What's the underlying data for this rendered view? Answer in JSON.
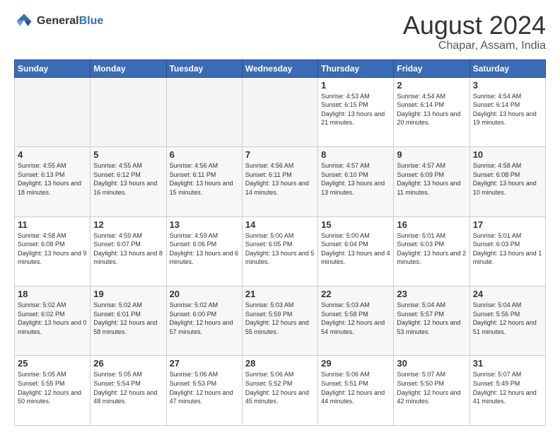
{
  "header": {
    "logo_general": "General",
    "logo_blue": "Blue",
    "month_year": "August 2024",
    "location": "Chapar, Assam, India"
  },
  "weekdays": [
    "Sunday",
    "Monday",
    "Tuesday",
    "Wednesday",
    "Thursday",
    "Friday",
    "Saturday"
  ],
  "weeks": [
    [
      {
        "day": "",
        "empty": true
      },
      {
        "day": "",
        "empty": true
      },
      {
        "day": "",
        "empty": true
      },
      {
        "day": "",
        "empty": true
      },
      {
        "day": "1",
        "sunrise": "4:53 AM",
        "sunset": "6:15 PM",
        "daylight": "13 hours and 21 minutes."
      },
      {
        "day": "2",
        "sunrise": "4:54 AM",
        "sunset": "6:14 PM",
        "daylight": "13 hours and 20 minutes."
      },
      {
        "day": "3",
        "sunrise": "4:54 AM",
        "sunset": "6:14 PM",
        "daylight": "13 hours and 19 minutes."
      }
    ],
    [
      {
        "day": "4",
        "sunrise": "4:55 AM",
        "sunset": "6:13 PM",
        "daylight": "13 hours and 18 minutes."
      },
      {
        "day": "5",
        "sunrise": "4:55 AM",
        "sunset": "6:12 PM",
        "daylight": "13 hours and 16 minutes."
      },
      {
        "day": "6",
        "sunrise": "4:56 AM",
        "sunset": "6:11 PM",
        "daylight": "13 hours and 15 minutes."
      },
      {
        "day": "7",
        "sunrise": "4:56 AM",
        "sunset": "6:11 PM",
        "daylight": "13 hours and 14 minutes."
      },
      {
        "day": "8",
        "sunrise": "4:57 AM",
        "sunset": "6:10 PM",
        "daylight": "13 hours and 13 minutes."
      },
      {
        "day": "9",
        "sunrise": "4:57 AM",
        "sunset": "6:09 PM",
        "daylight": "13 hours and 11 minutes."
      },
      {
        "day": "10",
        "sunrise": "4:58 AM",
        "sunset": "6:08 PM",
        "daylight": "13 hours and 10 minutes."
      }
    ],
    [
      {
        "day": "11",
        "sunrise": "4:58 AM",
        "sunset": "6:08 PM",
        "daylight": "13 hours and 9 minutes."
      },
      {
        "day": "12",
        "sunrise": "4:59 AM",
        "sunset": "6:07 PM",
        "daylight": "13 hours and 8 minutes."
      },
      {
        "day": "13",
        "sunrise": "4:59 AM",
        "sunset": "6:06 PM",
        "daylight": "13 hours and 6 minutes."
      },
      {
        "day": "14",
        "sunrise": "5:00 AM",
        "sunset": "6:05 PM",
        "daylight": "13 hours and 5 minutes."
      },
      {
        "day": "15",
        "sunrise": "5:00 AM",
        "sunset": "6:04 PM",
        "daylight": "13 hours and 4 minutes."
      },
      {
        "day": "16",
        "sunrise": "5:01 AM",
        "sunset": "6:03 PM",
        "daylight": "13 hours and 2 minutes."
      },
      {
        "day": "17",
        "sunrise": "5:01 AM",
        "sunset": "6:03 PM",
        "daylight": "13 hours and 1 minute."
      }
    ],
    [
      {
        "day": "18",
        "sunrise": "5:02 AM",
        "sunset": "6:02 PM",
        "daylight": "13 hours and 0 minutes."
      },
      {
        "day": "19",
        "sunrise": "5:02 AM",
        "sunset": "6:01 PM",
        "daylight": "12 hours and 58 minutes."
      },
      {
        "day": "20",
        "sunrise": "5:02 AM",
        "sunset": "6:00 PM",
        "daylight": "12 hours and 57 minutes."
      },
      {
        "day": "21",
        "sunrise": "5:03 AM",
        "sunset": "5:59 PM",
        "daylight": "12 hours and 55 minutes."
      },
      {
        "day": "22",
        "sunrise": "5:03 AM",
        "sunset": "5:58 PM",
        "daylight": "12 hours and 54 minutes."
      },
      {
        "day": "23",
        "sunrise": "5:04 AM",
        "sunset": "5:57 PM",
        "daylight": "12 hours and 53 minutes."
      },
      {
        "day": "24",
        "sunrise": "5:04 AM",
        "sunset": "5:56 PM",
        "daylight": "12 hours and 51 minutes."
      }
    ],
    [
      {
        "day": "25",
        "sunrise": "5:05 AM",
        "sunset": "5:55 PM",
        "daylight": "12 hours and 50 minutes."
      },
      {
        "day": "26",
        "sunrise": "5:05 AM",
        "sunset": "5:54 PM",
        "daylight": "12 hours and 48 minutes."
      },
      {
        "day": "27",
        "sunrise": "5:06 AM",
        "sunset": "5:53 PM",
        "daylight": "12 hours and 47 minutes."
      },
      {
        "day": "28",
        "sunrise": "5:06 AM",
        "sunset": "5:52 PM",
        "daylight": "12 hours and 45 minutes."
      },
      {
        "day": "29",
        "sunrise": "5:06 AM",
        "sunset": "5:51 PM",
        "daylight": "12 hours and 44 minutes."
      },
      {
        "day": "30",
        "sunrise": "5:07 AM",
        "sunset": "5:50 PM",
        "daylight": "12 hours and 42 minutes."
      },
      {
        "day": "31",
        "sunrise": "5:07 AM",
        "sunset": "5:49 PM",
        "daylight": "12 hours and 41 minutes."
      }
    ]
  ]
}
